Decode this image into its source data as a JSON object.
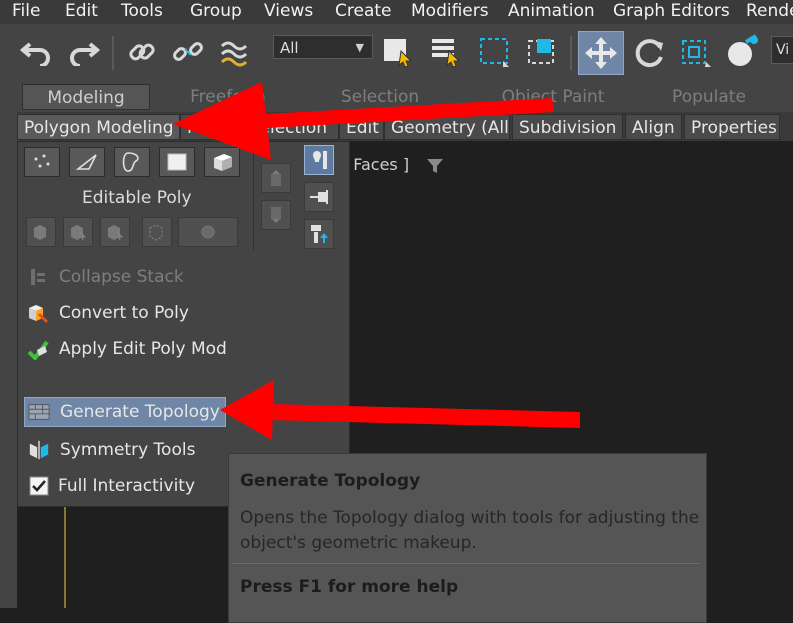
{
  "menubar": {
    "items": [
      "File",
      "Edit",
      "Tools",
      "Group",
      "Views",
      "Create",
      "Modifiers",
      "Animation",
      "Graph Editors",
      "Rende"
    ]
  },
  "toolbar": {
    "selection_filter": "All",
    "viewport_layout_label": "Vi",
    "icons": [
      "undo-icon",
      "redo-icon",
      "link-icon",
      "unlink-icon",
      "bind-space-warp-icon",
      "select-object-icon",
      "select-by-name-icon",
      "rect-selection-icon",
      "window-crossing-icon",
      "move-icon",
      "rotate-icon",
      "scale-icon",
      "reference-coord-icon"
    ]
  },
  "ribbon": {
    "tabs": [
      "Modeling",
      "Freeform",
      "Selection",
      "Object Paint",
      "Populate"
    ],
    "active_tab": "Modeling",
    "subtabs": [
      "Polygon Modeling",
      "Modify Selection",
      "Edit",
      "Geometry (All)",
      "Subdivision",
      "Align",
      "Properties"
    ]
  },
  "viewport": {
    "label": "d Faces ]"
  },
  "panel": {
    "editable_poly_label": "Editable Poly",
    "subobject_icons": [
      "vertex-icon",
      "edge-icon",
      "border-icon",
      "polygon-icon",
      "element-icon"
    ],
    "items": {
      "collapse_stack": "Collapse Stack",
      "convert_to_poly": "Convert to Poly",
      "apply_edit_poly_mod": "Apply Edit Poly Mod",
      "generate_topology": "Generate Topology",
      "symmetry_tools": "Symmetry Tools",
      "full_interactivity": "Full Interactivity"
    },
    "full_interactivity_checked": true
  },
  "tooltip": {
    "title": "Generate Topology",
    "description": "Opens the Topology dialog with tools for adjusting the object's geometric makeup.",
    "help": "Press F1 for more help"
  },
  "colors": {
    "accent_blue": "#6f86a6",
    "arrow_red": "#ff0000",
    "toolbar_icon_blue": "#1fb8e8"
  }
}
